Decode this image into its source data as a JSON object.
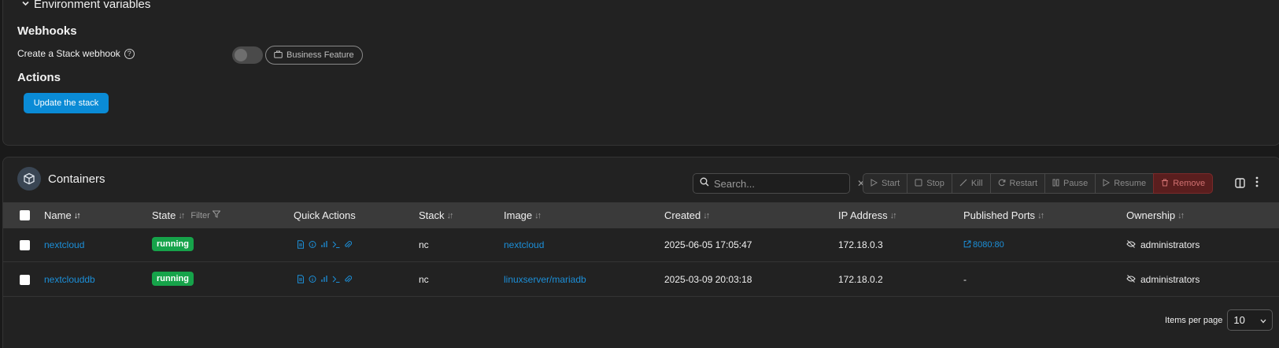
{
  "stack_editor": {
    "env_section": "Environment variables",
    "webhooks_title": "Webhooks",
    "webhook_label": "Create a Stack webhook",
    "business_feature": "Business Feature",
    "actions_title": "Actions",
    "update_button": "Update the stack"
  },
  "containers": {
    "title": "Containers",
    "search_placeholder": "Search...",
    "actions": [
      "Start",
      "Stop",
      "Kill",
      "Restart",
      "Pause",
      "Resume",
      "Remove"
    ],
    "columns": {
      "name": "Name",
      "state": "State",
      "state_filter": "Filter",
      "quick_actions": "Quick Actions",
      "stack": "Stack",
      "image": "Image",
      "created": "Created",
      "ip": "IP Address",
      "ports": "Published Ports",
      "ownership": "Ownership"
    },
    "rows": [
      {
        "name": "nextcloud",
        "state": "running",
        "stack": "nc",
        "image": "nextcloud",
        "created": "2025-06-05 17:05:47",
        "ip": "172.18.0.3",
        "ports": "8080:80",
        "ownership": "administrators"
      },
      {
        "name": "nextclouddb",
        "state": "running",
        "stack": "nc",
        "image": "linuxserver/mariadb",
        "created": "2025-03-09 20:03:18",
        "ip": "172.18.0.2",
        "ports": "-",
        "ownership": "administrators"
      }
    ],
    "pagination": {
      "label": "Items per page",
      "value": "10"
    }
  },
  "colors": {
    "accent": "#0a8bd6",
    "link": "#1c8fd8",
    "running": "#16a34a",
    "remove": "#5a1e1e"
  }
}
